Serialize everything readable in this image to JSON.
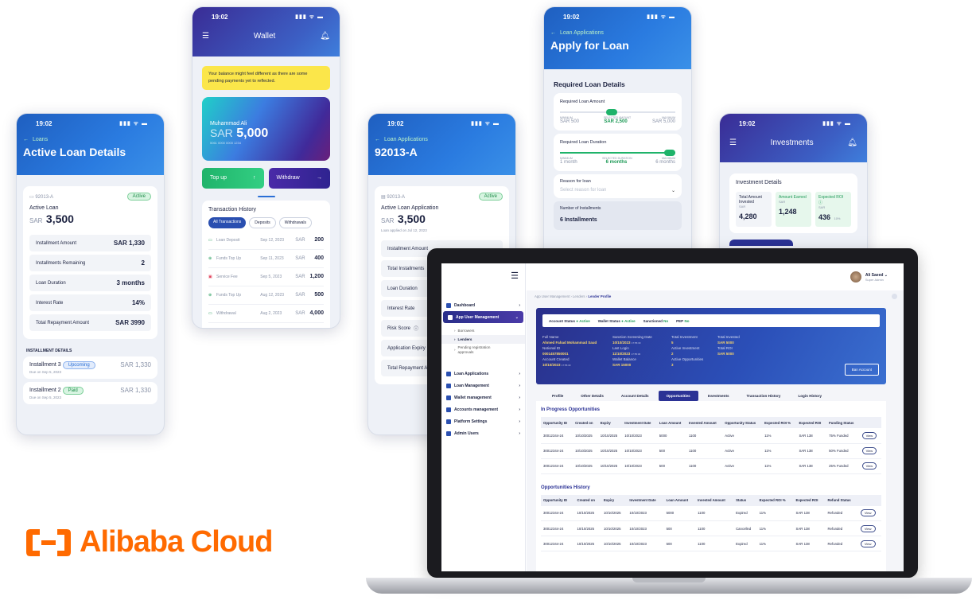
{
  "status_time": "19:02",
  "phone_active_loan": {
    "back": "Loans",
    "title": "Active Loan Details",
    "loan_id": "92013-A",
    "badge": "Active",
    "label": "Active Loan",
    "currency": "SAR",
    "amount": "3,500",
    "rows": [
      {
        "label": "Installment Amount",
        "value": "SAR 1,330"
      },
      {
        "label": "Installments Remaining",
        "value": "2"
      },
      {
        "label": "Loan Duration",
        "value": "3 months"
      },
      {
        "label": "Interest Rate",
        "value": "14%"
      },
      {
        "label": "Total Repayment Amount",
        "value": "SAR 3990"
      }
    ],
    "section": "INSTALLMENT DETAILS",
    "installments": [
      {
        "name": "Installment 3",
        "badge": "Upcoming",
        "due": "Due on Sep 5, 2023",
        "value": "SAR 1,330"
      },
      {
        "name": "Installment 2",
        "badge": "Paid",
        "due": "Due on Sep 5, 2023",
        "value": "SAR 1,330"
      }
    ]
  },
  "phone_wallet": {
    "title": "Wallet",
    "notice": "Your balance might feel different as there are some pending payments yet to reflected.",
    "card_name": "Muhammad Ali",
    "card_currency": "SAR",
    "card_amount": "5,000",
    "card_number": "5061 0000 0000 1234",
    "topup": "Top up",
    "withdraw": "Withdraw",
    "history_title": "Transaction History",
    "filters": [
      "All Transactions",
      "Deposits",
      "Withdrawals"
    ],
    "transactions": [
      {
        "name": "Loan Deposit",
        "date": "Sep 12, 2023",
        "amount": "200"
      },
      {
        "name": "Funds Top Up",
        "date": "Sep 11, 2023",
        "amount": "400"
      },
      {
        "name": "Service Fee",
        "date": "Sep 5, 2023",
        "amount": "1,200"
      },
      {
        "name": "Funds Top Up",
        "date": "Aug 12, 2023",
        "amount": "500"
      },
      {
        "name": "Withdrawal",
        "date": "Aug 2, 2023",
        "amount": "4,000"
      }
    ]
  },
  "phone_application": {
    "back": "Loan Applications",
    "title": "92013-A",
    "loan_id": "92013-A",
    "badge": "Active",
    "label": "Active Loan Application",
    "currency": "SAR",
    "amount": "3,500",
    "applied": "Loan applied on Jul 12, 2023",
    "rows": [
      "Installment Amount",
      "Total Installments",
      "Loan Duration",
      "Interest Rate",
      "Risk Score",
      "Application Expiry",
      "Total Repayment A"
    ]
  },
  "phone_apply": {
    "back": "Loan Applications",
    "title": "Apply for Loan",
    "section": "Required Loan Details",
    "amount_label": "Required Loan Amount",
    "amount_min_label": "MINIMUM",
    "amount_min": "SAR 500",
    "amount_sel_label": "SELECTED AMOUNT",
    "amount_sel": "SAR 2,500",
    "amount_max_label": "MAXIMUM",
    "amount_max": "SAR 5,000",
    "duration_label": "Required Loan Duration",
    "duration_min_label": "MINIMUM",
    "duration_min": "1 month",
    "duration_sel_label": "SELECTED DURATION",
    "duration_sel": "6 months",
    "duration_max_label": "MAXIMUM",
    "duration_max": "6 months",
    "reason_label": "Reason for loan",
    "reason_placeholder": "Select reason for loan",
    "inst_label": "Number of Installments",
    "inst_value": "6 Installments"
  },
  "phone_invest": {
    "title": "Investments",
    "section": "Investment Details",
    "stats": [
      {
        "label": "Total Amount Invested",
        "cur": "SAR",
        "value": "4,280",
        "extra": ""
      },
      {
        "label": "Amount Earned",
        "cur": "SAR",
        "value": "1,248",
        "extra": ""
      },
      {
        "label": "Expected ROI",
        "cur": "SAR",
        "value": "436",
        "extra": "10%"
      }
    ]
  },
  "admin": {
    "user_name": "Ali Saeed",
    "user_role": "Super Admin",
    "breadcrumb": [
      "App User Management",
      "Lenders",
      "Lender Profile"
    ],
    "sidebar": [
      {
        "label": "Dashboard"
      },
      {
        "label": "App User Management"
      },
      {
        "label": "Loan Applications"
      },
      {
        "label": "Loan Management"
      },
      {
        "label": "Wallet management"
      },
      {
        "label": "Accounts management"
      },
      {
        "label": "Platform Settings"
      },
      {
        "label": "Admin Users"
      }
    ],
    "sub_items": [
      "Borrowers",
      "Lenders",
      "Pending registration approvals"
    ],
    "status_bar": {
      "account_status_label": "Account Status",
      "account_status": "Active",
      "wallet_status_label": "Wallet Status",
      "wallet_status": "Active",
      "sanctioned_label": "Sanctioned",
      "sanctioned": "No",
      "pep_label": "PEP",
      "pep": "No"
    },
    "profile": {
      "full_name_label": "Full Name",
      "full_name": "Ahmed Fahad Mohammad Saud",
      "national_id_label": "National ID",
      "national_id": "0001457850001",
      "created_label": "Account Created",
      "created": "10/10/2023",
      "screening_label": "Sanction Screening Date",
      "screening": "10/10/2023",
      "last_login_label": "Last Login",
      "last_login": "11/10/2023",
      "wallet_label": "Wallet Balance",
      "wallet": "SAR 15000",
      "total_inv_label": "Total Investment",
      "total_inv": "5",
      "active_inv_label": "Active Investment",
      "active_inv": "2",
      "active_opp_label": "Active Opportunities",
      "active_opp": "3",
      "total_invested_label": "Total Invested",
      "total_invested": "SAR 5000",
      "total_roi_label": "Total ROI",
      "total_roi": "SAR 5000",
      "time": "17:55:30"
    },
    "ban_button": "Ban Account",
    "tabs": [
      "Profile",
      "Other Details",
      "Account Details",
      "Opportunities",
      "Investments",
      "Transaction History",
      "Login History"
    ],
    "inprogress_title": "In Progress Opportunities",
    "inprogress_headers": [
      "Opportunity ID",
      "Created on",
      "Expiry",
      "Investment Date",
      "Loan Amount",
      "Invested Amount",
      "Opportunity Status",
      "Expected ROI %",
      "Expected ROI",
      "Funding Status",
      ""
    ],
    "inprogress_rows": [
      [
        "30012344-24",
        "10/10/2025",
        "10/10/2025",
        "10/10/2023",
        "5000",
        "1100",
        "Active",
        "11%",
        "SAR 138",
        "75% Funded",
        "View"
      ],
      [
        "30012344-24",
        "10/10/2025",
        "10/10/2025",
        "10/10/2023",
        "500",
        "1100",
        "Active",
        "11%",
        "SAR 138",
        "50% Funded",
        "View"
      ],
      [
        "30012344-24",
        "10/10/2025",
        "10/10/2025",
        "10/10/2023",
        "500",
        "1100",
        "Active",
        "11%",
        "SAR 138",
        "25% Funded",
        "View"
      ]
    ],
    "history_title": "Opportunities History",
    "history_headers": [
      "Opportunity ID",
      "Created on",
      "Expiry",
      "Investment Date",
      "Loan Amount",
      "Invested Amount",
      "Status",
      "Expected ROI %",
      "Expected ROI",
      "Refund Status",
      ""
    ],
    "history_rows": [
      [
        "30012344-24",
        "10/10/2025",
        "10/10/2025",
        "10/10/2023",
        "5000",
        "1100",
        "Expired",
        "11%",
        "SAR 138",
        "Refunded",
        "View"
      ],
      [
        "30012344-24",
        "10/10/2025",
        "10/10/2025",
        "10/10/2023",
        "500",
        "1100",
        "Cancelled",
        "11%",
        "SAR 138",
        "Refunded",
        "View"
      ],
      [
        "30012344-24",
        "10/10/2025",
        "10/10/2025",
        "10/10/2023",
        "500",
        "1100",
        "Expired",
        "11%",
        "SAR 138",
        "Refunded",
        "View"
      ]
    ]
  },
  "logo_text": "Alibaba Cloud",
  "colors": {
    "brand_orange": "#ff6a00",
    "primary_blue": "#2a6fd6",
    "success_green": "#1e9a57",
    "navy": "#2b3295"
  }
}
